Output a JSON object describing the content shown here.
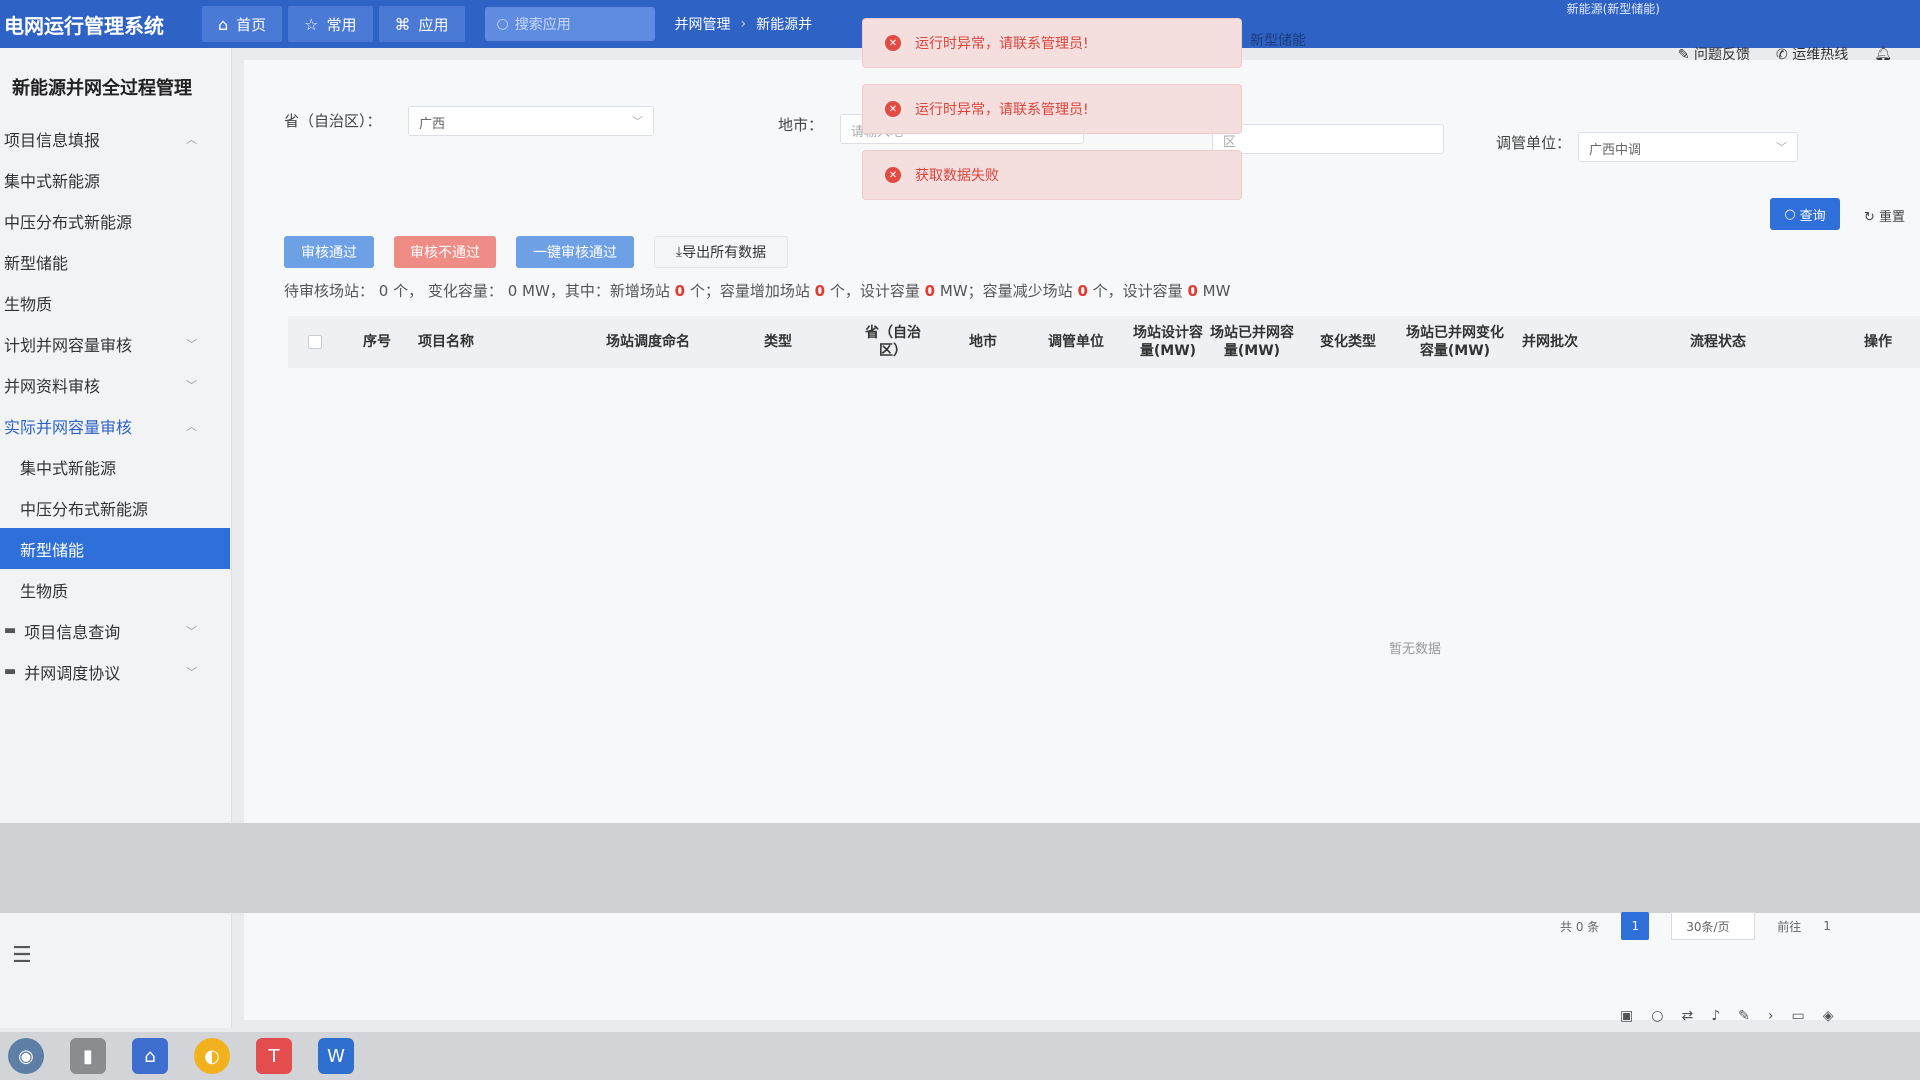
{
  "app": {
    "title": "电网运行管理系统"
  },
  "topbar": {
    "tabs": [
      {
        "icon": "home-icon",
        "label": "首页"
      },
      {
        "icon": "star-icon",
        "label": "常用"
      },
      {
        "icon": "apps-icon",
        "label": "应用"
      }
    ],
    "search_placeholder": "搜索应用",
    "breadcrumb": [
      "并网管理",
      "新能源并"
    ],
    "breadcrumb_tail": "新型储能",
    "user_text": "新能源(新型储能)"
  },
  "tools": {
    "feedback": "问题反馈",
    "hotline": "运维热线"
  },
  "sidebar": {
    "title": "新能源并网全过程管理",
    "items": [
      {
        "label": "项目信息填报",
        "level": 0
      },
      {
        "label": "集中式新能源",
        "level": 1
      },
      {
        "label": "中压分布式新能源",
        "level": 1
      },
      {
        "label": "新型储能",
        "level": 1
      },
      {
        "label": "生物质",
        "level": 1
      },
      {
        "label": "计划并网容量审核",
        "level": 0
      },
      {
        "label": "并网资料审核",
        "level": 0
      },
      {
        "label": "实际并网容量审核",
        "level": 0
      },
      {
        "label": "集中式新能源",
        "level": 2
      },
      {
        "label": "中压分布式新能源",
        "level": 2
      },
      {
        "label": "新型储能",
        "level": 2
      },
      {
        "label": "生物质",
        "level": 2
      },
      {
        "label": "项目信息查询",
        "level": 0
      },
      {
        "label": "并网调度协议",
        "level": 0
      }
    ]
  },
  "filters": {
    "province_label": "省（自治区）：",
    "province_value": "广西",
    "city_label": "地市：",
    "city_placeholder": "请输入地",
    "county_placeholder": "区",
    "unit_label": "调管单位：",
    "unit_value": "广西中调",
    "query": "查询",
    "reset": "重置"
  },
  "actions": {
    "approve": "审核通过",
    "reject": "审核不通过",
    "approve_all": "一键审核通过",
    "export": "导出所有数据"
  },
  "summary": {
    "pending_label": "待审核场站：",
    "pending_count": "0",
    "unit_ge": "个，",
    "change_label": "变化容量：",
    "change_value": "0",
    "mw": "MW",
    "among": "，其中：新增场站",
    "new_count": "0",
    "inc_label": "个；容量增加场站",
    "inc_count": "0",
    "design_label": "个，设计容量",
    "design_value": "0",
    "dec_label": "MW；容量减少场站",
    "dec_count": "0",
    "design_label2": "个，设计容量",
    "design_value2": "0",
    "mw2": "MW"
  },
  "table": {
    "headers": [
      "序号",
      "项目名称",
      "场站调度命名",
      "类型",
      "省（自治区）",
      "地市",
      "调管单位",
      "场站设计容量(MW)",
      "场站已并网容量(MW)",
      "变化类型",
      "场站已并网变化容量(MW)",
      "并网批次",
      "流程状态",
      "操作"
    ],
    "empty_text": "暂无数据"
  },
  "pagination": {
    "total": "共 0 条",
    "page": "1",
    "size": "30条/页",
    "goto": "前往",
    "goto_value": "1"
  },
  "toasts": [
    "运行时异常，请联系管理员!",
    "运行时异常，请联系管理员!",
    "获取数据失败"
  ],
  "colors": {
    "primary": "#2e62c4",
    "danger": "#e24a44",
    "selected": "#2e6fd9"
  }
}
